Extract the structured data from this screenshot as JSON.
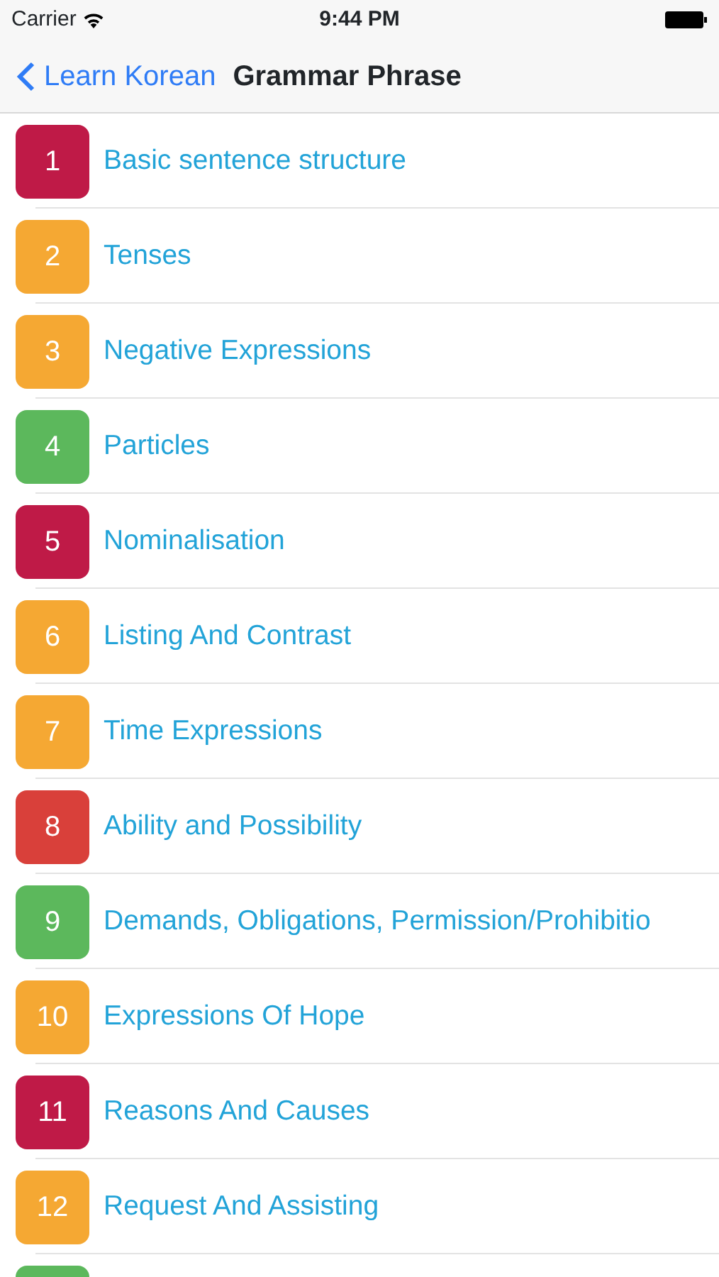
{
  "status_bar": {
    "carrier": "Carrier",
    "time": "9:44 PM"
  },
  "nav": {
    "back": "Learn Korean",
    "title": "Grammar Phrase"
  },
  "items": [
    {
      "number": "1",
      "title": "Basic sentence structure",
      "color": "#bf1a47"
    },
    {
      "number": "2",
      "title": "Tenses",
      "color": "#f5a833"
    },
    {
      "number": "3",
      "title": "Negative Expressions",
      "color": "#f5a833"
    },
    {
      "number": "4",
      "title": "Particles",
      "color": "#5cb85c"
    },
    {
      "number": "5",
      "title": "Nominalisation",
      "color": "#bf1a47"
    },
    {
      "number": "6",
      "title": "Listing And Contrast",
      "color": "#f5a833"
    },
    {
      "number": "7",
      "title": "Time Expressions",
      "color": "#f5a833"
    },
    {
      "number": "8",
      "title": "Ability and Possibility",
      "color": "#d9403a"
    },
    {
      "number": "9",
      "title": "Demands, Obligations, Permission/Prohibitio",
      "color": "#5cb85c"
    },
    {
      "number": "10",
      "title": "Expressions Of Hope",
      "color": "#f5a833"
    },
    {
      "number": "11",
      "title": "Reasons And Causes",
      "color": "#bf1a47"
    },
    {
      "number": "12",
      "title": "Request And Assisting",
      "color": "#f5a833"
    },
    {
      "color": "#5cb85c"
    }
  ]
}
